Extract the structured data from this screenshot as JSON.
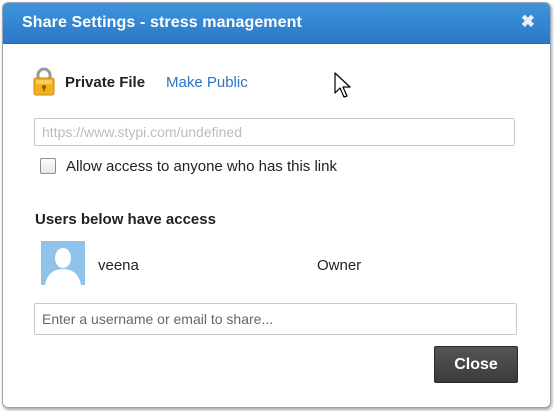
{
  "dialog": {
    "title": "Share Settings - stress management",
    "close_icon": "close-icon"
  },
  "privacy": {
    "lock_icon": "lock-icon",
    "status": "Private File",
    "toggle_link": "Make Public"
  },
  "link": {
    "placeholder": "https://www.stypi.com/undefined"
  },
  "allow_access": {
    "checked": false,
    "label": "Allow access to anyone who has this link"
  },
  "users": {
    "heading": "Users below have access",
    "list": [
      {
        "avatar_icon": "user-avatar-icon",
        "name": "veena",
        "role": "Owner"
      }
    ]
  },
  "share_input": {
    "placeholder": "Enter a username or email to share..."
  },
  "footer": {
    "close_label": "Close"
  },
  "colors": {
    "titlebar": "#3a8ad6",
    "link": "#2b76c0",
    "close_button": "#444444",
    "avatar": "#8fc3ea"
  }
}
